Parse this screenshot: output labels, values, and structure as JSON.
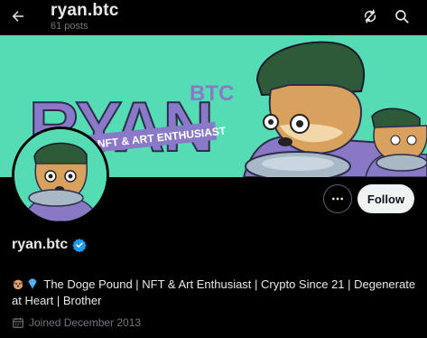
{
  "header": {
    "title": "ryan.btc",
    "post_count": "61 posts",
    "back_icon": "arrow-left-icon",
    "refresh_icon": "refresh-icon",
    "search_icon": "search-icon"
  },
  "banner": {
    "brand_text": "RYAN",
    "brand_superscript": "BTC",
    "tagline": "NFT & ART ENTHUSIAST",
    "background_color": "#56dcb4",
    "text_color": "#8a79c9"
  },
  "profile": {
    "display_name": "ryan.btc",
    "verified": true,
    "verified_color": "#1d9bf0",
    "bio": "The Doge Pound | NFT & Art Enthusiast | Crypto  Since 21 | Degenerate at Heart | Brother",
    "joined": "Joined December 2013"
  },
  "actions": {
    "follow_label": "Follow",
    "more_icon": "more-horizontal-icon"
  }
}
